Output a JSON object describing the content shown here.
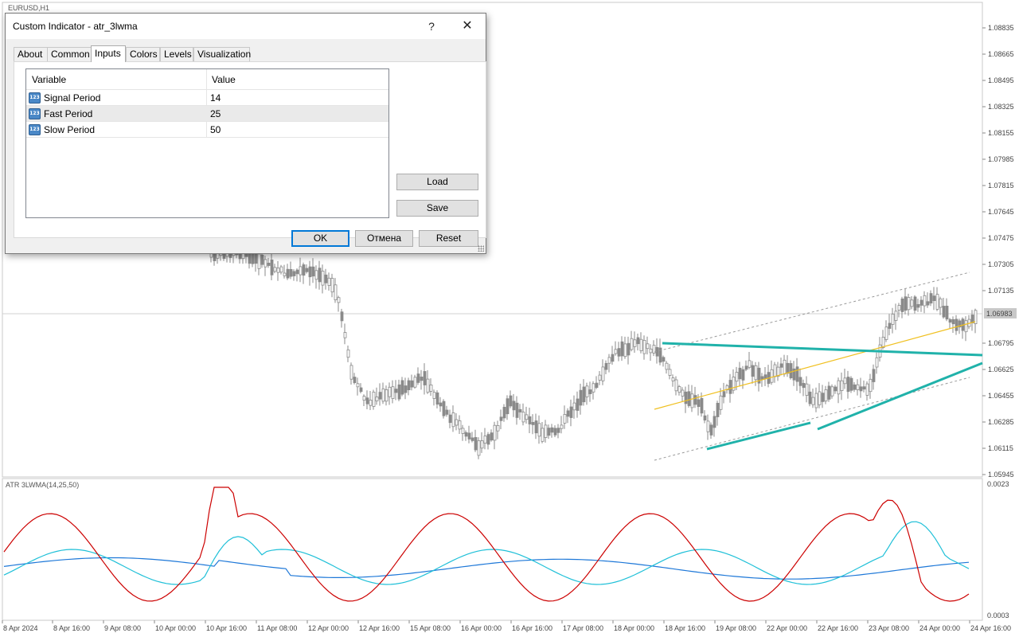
{
  "chart": {
    "symbol_label": "EURUSD,H1",
    "current_price": "1.06983",
    "price_ticks": [
      "1.08835",
      "1.08665",
      "1.08495",
      "1.08325",
      "1.08155",
      "1.07985",
      "1.07815",
      "1.07645",
      "1.07475",
      "1.07305",
      "1.07135",
      "1.06983",
      "1.06795",
      "1.06625",
      "1.06455",
      "1.06285",
      "1.06115",
      "1.05945"
    ],
    "indicator_label": "ATR 3LWMA(14,25,50)",
    "indicator_ticks": [
      "0.0023",
      "0.0003"
    ],
    "time_ticks": [
      "8 Apr 2024",
      "8 Apr 16:00",
      "9 Apr 08:00",
      "10 Apr 00:00",
      "10 Apr 16:00",
      "11 Apr 08:00",
      "12 Apr 00:00",
      "12 Apr 16:00",
      "15 Apr 08:00",
      "16 Apr 00:00",
      "16 Apr 16:00",
      "17 Apr 08:00",
      "18 Apr 00:00",
      "18 Apr 16:00",
      "19 Apr 08:00",
      "22 Apr 00:00",
      "22 Apr 16:00",
      "23 Apr 08:00",
      "24 Apr 00:00",
      "24 Apr 16:00"
    ],
    "colors": {
      "candles": "#8a8a8a",
      "trend_lines": "#20b2aa",
      "moving_average": "#f0c020",
      "channel": "#9a9a9a",
      "atr_fast": "#cc0000",
      "atr_mid": "#20c0d8",
      "atr_slow": "#1e78d8"
    }
  },
  "dialog": {
    "title": "Custom Indicator - atr_3lwma",
    "help_icon": "?",
    "close_icon": "✕",
    "tabs": [
      {
        "label": "About",
        "active": false
      },
      {
        "label": "Common",
        "active": false
      },
      {
        "label": "Inputs",
        "active": true
      },
      {
        "label": "Colors",
        "active": false
      },
      {
        "label": "Levels",
        "active": false
      },
      {
        "label": "Visualization",
        "active": false
      }
    ],
    "table": {
      "headers": {
        "variable": "Variable",
        "value": "Value"
      },
      "rows": [
        {
          "variable": "Signal Period",
          "value": "14",
          "icon": "123"
        },
        {
          "variable": "Fast Period",
          "value": "25",
          "icon": "123"
        },
        {
          "variable": "Slow Period",
          "value": "50",
          "icon": "123"
        }
      ]
    },
    "buttons": {
      "load": "Load",
      "save": "Save",
      "ok": "OK",
      "cancel": "Отмена",
      "reset": "Reset"
    }
  }
}
